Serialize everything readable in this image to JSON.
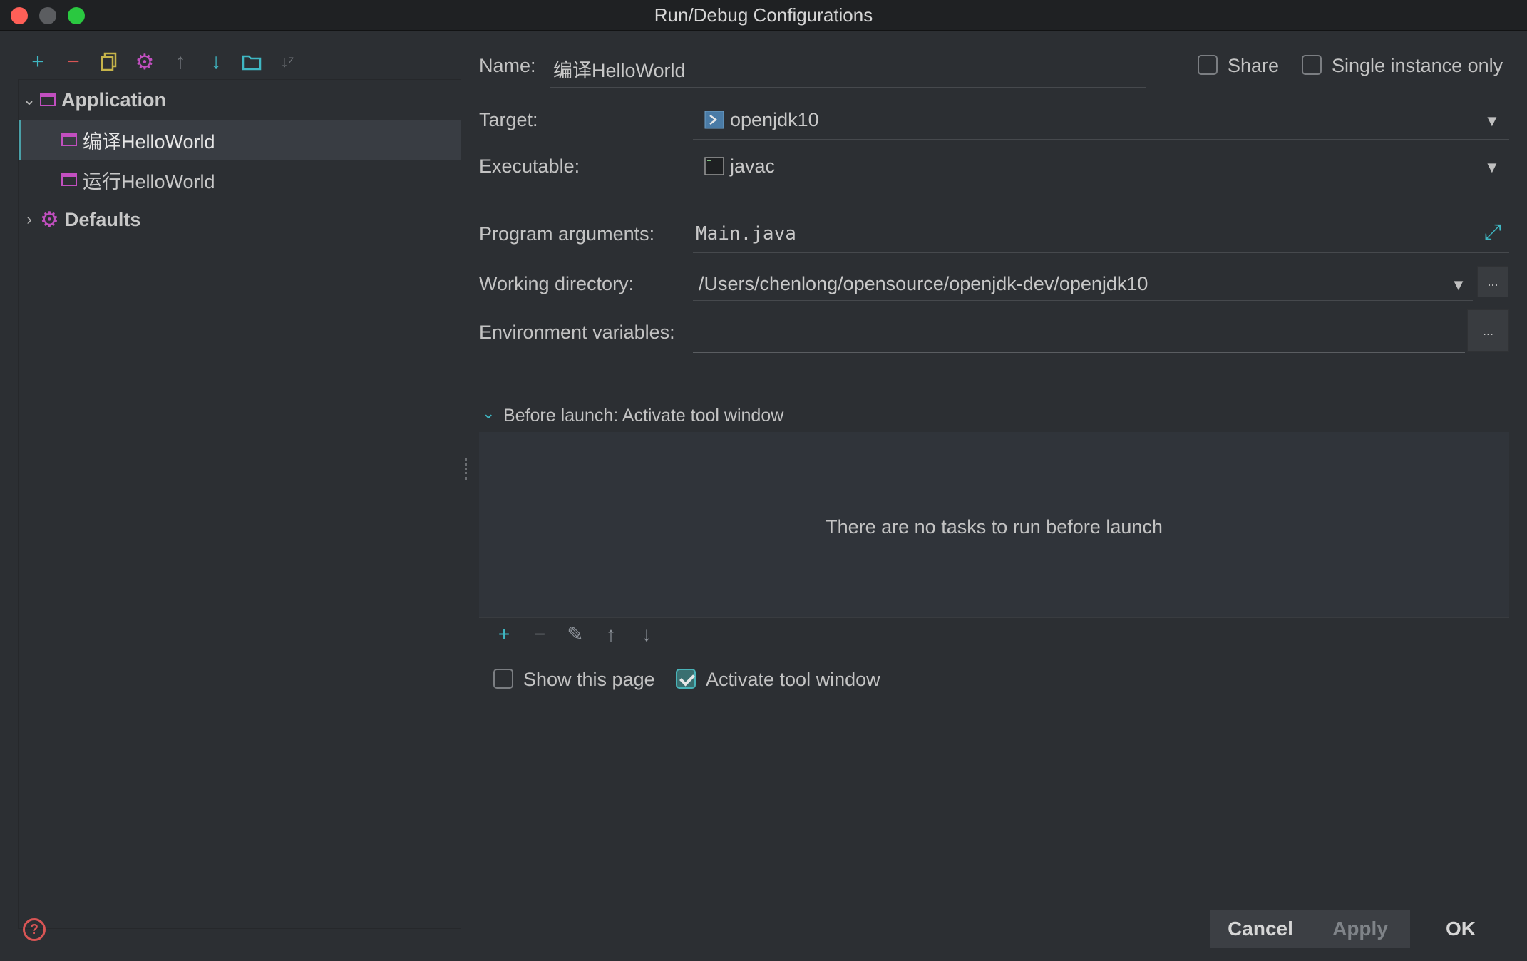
{
  "window": {
    "title": "Run/Debug Configurations"
  },
  "toolbar": {
    "icons": [
      "add-icon",
      "remove-icon",
      "copy-icon",
      "gear-icon",
      "arrow-up-icon",
      "arrow-down-icon",
      "folder-icon",
      "sort-az-icon"
    ]
  },
  "tree": {
    "application_label": "Application",
    "items": [
      {
        "label": "编译HelloWorld",
        "selected": true
      },
      {
        "label": "运行HelloWorld",
        "selected": false
      }
    ],
    "defaults_label": "Defaults"
  },
  "form": {
    "name_label": "Name:",
    "name_value": "编译HelloWorld",
    "share_label": "Share",
    "share_checked": false,
    "single_instance_label": "Single instance only",
    "single_instance_checked": false,
    "target_label": "Target:",
    "target_value": "openjdk10",
    "executable_label": "Executable:",
    "executable_value": "javac",
    "program_args_label": "Program arguments:",
    "program_args_value": "Main.java",
    "working_dir_label": "Working directory:",
    "working_dir_value": "/Users/chenlong/opensource/openjdk-dev/openjdk10",
    "env_label": "Environment variables:",
    "env_value": "",
    "browse_label": "..."
  },
  "before_launch": {
    "header": "Before launch: Activate tool window",
    "empty_text": "There are no tasks to run before launch",
    "show_page_label": "Show this page",
    "show_page_checked": false,
    "activate_label": "Activate tool window",
    "activate_checked": true
  },
  "footer": {
    "cancel": "Cancel",
    "apply": "Apply",
    "ok": "OK"
  },
  "colors": {
    "accent": "#3fb7c3",
    "config_icon": "#c24fc0",
    "remove": "#d95555"
  }
}
